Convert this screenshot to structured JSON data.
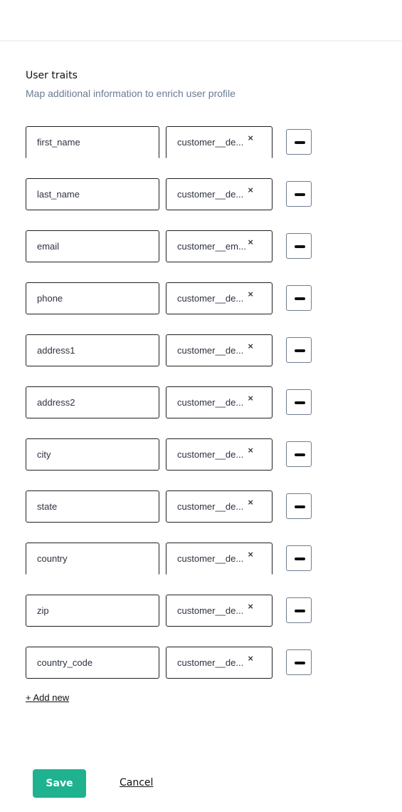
{
  "section": {
    "title": "User traits",
    "subtitle": "Map additional information to enrich user profile"
  },
  "mappings": [
    {
      "key": "first_name",
      "value": "customer__de...",
      "clear_icon": "close-icon",
      "remove_icon": "minus-icon"
    },
    {
      "key": "last_name",
      "value": "customer__de...",
      "clear_icon": "close-icon",
      "remove_icon": "minus-icon"
    },
    {
      "key": "email",
      "value": "customer__em...",
      "clear_icon": "close-icon",
      "remove_icon": "minus-icon"
    },
    {
      "key": "phone",
      "value": "customer__de...",
      "clear_icon": "close-icon",
      "remove_icon": "minus-icon"
    },
    {
      "key": "address1",
      "value": "customer__de...",
      "clear_icon": "close-icon",
      "remove_icon": "minus-icon"
    },
    {
      "key": "address2",
      "value": "customer__de...",
      "clear_icon": "close-icon",
      "remove_icon": "minus-icon"
    },
    {
      "key": "city",
      "value": "customer__de...",
      "clear_icon": "close-icon",
      "remove_icon": "minus-icon"
    },
    {
      "key": "state",
      "value": "customer__de...",
      "clear_icon": "close-icon",
      "remove_icon": "minus-icon"
    },
    {
      "key": "country",
      "value": "customer__de...",
      "clear_icon": "close-icon",
      "remove_icon": "minus-icon"
    },
    {
      "key": "zip",
      "value": "customer__de...",
      "clear_icon": "close-icon",
      "remove_icon": "minus-icon"
    },
    {
      "key": "country_code",
      "value": "customer__de...",
      "clear_icon": "close-icon",
      "remove_icon": "minus-icon"
    }
  ],
  "clear_glyph": "×",
  "add_new_label": "+ Add new",
  "actions": {
    "save_label": "Save",
    "cancel_label": "Cancel"
  },
  "colors": {
    "primary": "#1fb28f",
    "subtitle": "#6b7c93"
  }
}
